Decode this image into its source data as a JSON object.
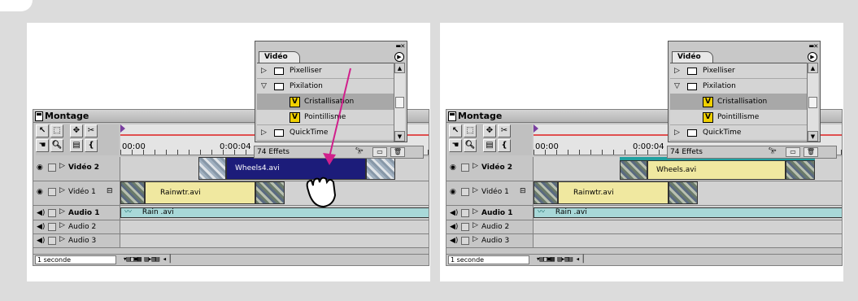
{
  "screens": [
    {
      "montage": {
        "title": "Montage",
        "time_start": "00:00",
        "time_end": "0:00:04",
        "tracks": {
          "video2": "Vidéo 2",
          "video1": "Vidéo 1",
          "audio1": "Audio 1",
          "audio2": "Audio 2",
          "audio3": "Audio 3"
        },
        "clips": {
          "video2": "Wheels4.avi",
          "video1": "Rainwtr.avi",
          "audio1": "Rain .avi"
        },
        "scale": "1 seconde"
      },
      "palette": {
        "tab": "Vidéo",
        "rows": [
          "Pixelliser",
          "Pixilation",
          "Cristallisation",
          "Pointillisme",
          "QuickTime"
        ],
        "count": "74 Effets"
      }
    },
    {
      "montage": {
        "title": "Montage",
        "time_start": "00:00",
        "time_end": "0:00:04",
        "tracks": {
          "video2": "Vidéo 2",
          "video1": "Vidéo 1",
          "audio1": "Audio 1",
          "audio2": "Audio 2",
          "audio3": "Audio 3"
        },
        "clips": {
          "video2": "Wheels.avi",
          "video1": "Rainwtr.avi",
          "audio1": "Rain .avi"
        },
        "scale": "1 seconde"
      },
      "palette": {
        "tab": "Vidéo",
        "rows": [
          "Pixelliser",
          "Pixilation",
          "Cristallisation",
          "Pointillisme",
          "QuickTime"
        ],
        "count": "74 Effets"
      }
    }
  ],
  "colors": {
    "arrow": "#d0208c",
    "clip_video": "#f0e8a0",
    "clip_selected": "#1c1c7a",
    "clip_audio": "#a8d8d8",
    "fx_icon": "#f0d000"
  },
  "icons": [
    "hand-cursor-icon",
    "effect-fx-icon",
    "folder-icon",
    "eye-icon",
    "speaker-icon"
  ]
}
